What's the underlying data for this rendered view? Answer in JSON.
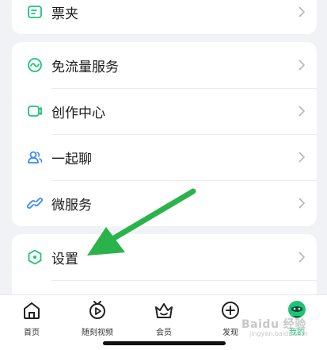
{
  "menu_groups": {
    "top": {
      "items": [
        {
          "label": "票夹",
          "icon": "ticket-folder-icon"
        }
      ]
    },
    "services": {
      "items": [
        {
          "label": "免流量服务",
          "icon": "wave-circle-icon"
        },
        {
          "label": "创作中心",
          "icon": "camera-icon"
        },
        {
          "label": "一起聊",
          "icon": "people-icon"
        },
        {
          "label": "微服务",
          "icon": "link-icon"
        }
      ]
    },
    "settings": {
      "items": [
        {
          "label": "设置",
          "icon": "hexagon-gear-icon"
        }
      ]
    }
  },
  "bottom_nav": {
    "items": [
      {
        "label": "首页",
        "icon": "home-icon"
      },
      {
        "label": "随刻视频",
        "icon": "video-play-icon"
      },
      {
        "label": "会员",
        "icon": "crown-icon"
      },
      {
        "label": "发现",
        "icon": "plus-circle-icon"
      },
      {
        "label": "我的",
        "icon": "profile-mascot-icon",
        "active": true
      }
    ]
  },
  "watermark": {
    "text": "Baidu 经验",
    "sub": "jingyan.baidu.com"
  },
  "colors": {
    "accent": "#1ec37a",
    "background": "#f1f2f5",
    "arrow": "#2bb34b"
  }
}
